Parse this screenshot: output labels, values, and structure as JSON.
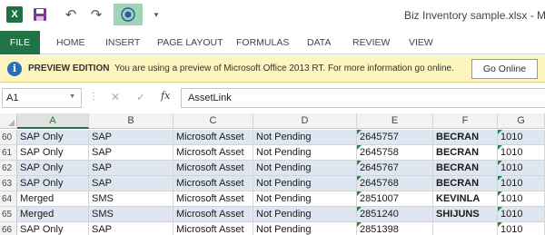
{
  "app": {
    "logo_letter": "X",
    "doc_title": "Biz Inventory sample.xlsx - Micr",
    "more_glyph": "▾"
  },
  "ribbon": {
    "tabs": [
      "FILE",
      "HOME",
      "INSERT",
      "PAGE LAYOUT",
      "FORMULAS",
      "DATA",
      "REVIEW",
      "VIEW"
    ]
  },
  "message_bar": {
    "title": "PREVIEW EDITION",
    "text": "You are using a preview of Microsoft Office 2013 RT. For more information go online.",
    "button": "Go Online"
  },
  "formula_bar": {
    "name_box": "A1",
    "fx": "fx",
    "value": "AssetLink"
  },
  "grid": {
    "columns": [
      "A",
      "B",
      "C",
      "D",
      "E",
      "F",
      "G"
    ],
    "selected_column": "A",
    "rows": [
      {
        "num": "60",
        "cells": [
          "SAP Only",
          "SAP",
          "Microsoft Asset",
          "Not Pending",
          "2645757",
          "BECRAN",
          "1010"
        ]
      },
      {
        "num": "61",
        "cells": [
          "SAP Only",
          "SAP",
          "Microsoft Asset",
          "Not Pending",
          "2645758",
          "BECRAN",
          "1010"
        ]
      },
      {
        "num": "62",
        "cells": [
          "SAP Only",
          "SAP",
          "Microsoft Asset",
          "Not Pending",
          "2645767",
          "BECRAN",
          "1010"
        ]
      },
      {
        "num": "63",
        "cells": [
          "SAP Only",
          "SAP",
          "Microsoft Asset",
          "Not Pending",
          "2645768",
          "BECRAN",
          "1010"
        ]
      },
      {
        "num": "64",
        "cells": [
          "Merged",
          "SMS",
          "Microsoft Asset",
          "Not Pending",
          "2851007",
          "KEVINLA",
          "1010"
        ]
      },
      {
        "num": "65",
        "cells": [
          "Merged",
          "SMS",
          "Microsoft Asset",
          "Not Pending",
          "2851240",
          "SHIJUNS",
          "1010"
        ]
      },
      {
        "num": "66",
        "cells": [
          "SAP Only",
          "SAP",
          "Microsoft Asset",
          "Not Pending",
          "2851398",
          "",
          "1010"
        ]
      }
    ]
  },
  "colors": {
    "excel_green": "#217346",
    "band_blue": "#dde6f1",
    "message_bar": "#fdf5bf"
  }
}
